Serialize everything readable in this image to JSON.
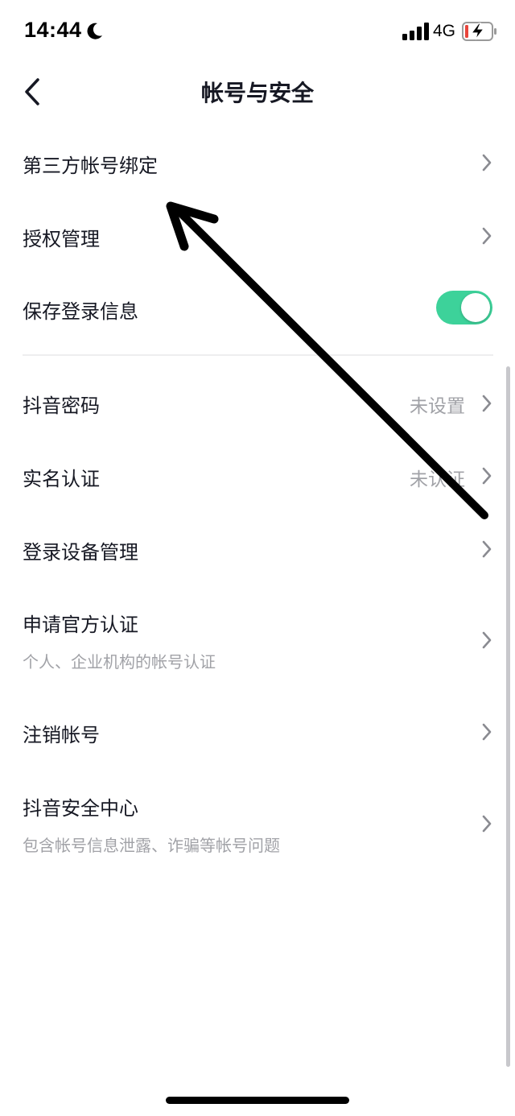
{
  "status_bar": {
    "time": "14:44",
    "network": "4G",
    "icons": [
      "moon-icon",
      "signal-icon",
      "battery-charging-icon"
    ]
  },
  "nav": {
    "title": "帐号与安全",
    "back_icon": "chevron-left-icon"
  },
  "rows": {
    "third_party": {
      "title": "第三方帐号绑定"
    },
    "authorization": {
      "title": "授权管理"
    },
    "save_login": {
      "title": "保存登录信息",
      "toggle_on": true
    },
    "password": {
      "title": "抖音密码",
      "value": "未设置"
    },
    "real_name": {
      "title": "实名认证",
      "value": "未认证"
    },
    "devices": {
      "title": "登录设备管理"
    },
    "official": {
      "title": "申请官方认证",
      "subtitle": "个人、企业机构的帐号认证"
    },
    "deactivate": {
      "title": "注销帐号"
    },
    "security_center": {
      "title": "抖音安全中心",
      "subtitle": "包含帐号信息泄露、诈骗等帐号问题"
    }
  },
  "colors": {
    "toggle_on": "#3dd29a",
    "text_primary": "#161823",
    "text_secondary": "#a1a2a7",
    "chevron": "#8a8b91",
    "battery_low": "#e8453c"
  }
}
